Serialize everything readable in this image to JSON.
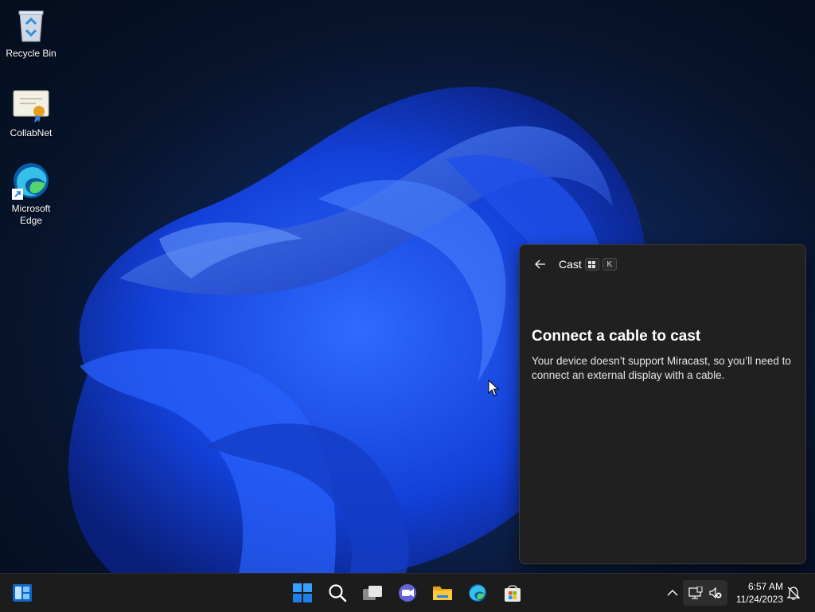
{
  "desktop": {
    "icons": [
      {
        "label": "Recycle Bin",
        "icon": "recycle-bin-icon"
      },
      {
        "label": "CollabNet",
        "icon": "certificate-icon"
      },
      {
        "label": "Microsoft Edge",
        "icon": "edge-icon"
      }
    ]
  },
  "cast_panel": {
    "title": "Cast",
    "shortcut_keys": [
      "⊞",
      "K"
    ],
    "heading": "Connect a cable to cast",
    "body": "Your device doesn’t support Miracast, so you’ll need to connect an external display with a cable."
  },
  "taskbar": {
    "items": [
      "widgets-icon",
      "start-icon",
      "search-icon",
      "task-view-icon",
      "chat-icon",
      "file-explorer-icon",
      "edge-icon",
      "store-icon"
    ],
    "tray": {
      "time": "6:57 AM",
      "date": "11/24/2023"
    }
  },
  "colors": {
    "accent": "#1e5bff",
    "panel_bg": "#202020",
    "taskbar_bg": "#1c1c1c"
  }
}
